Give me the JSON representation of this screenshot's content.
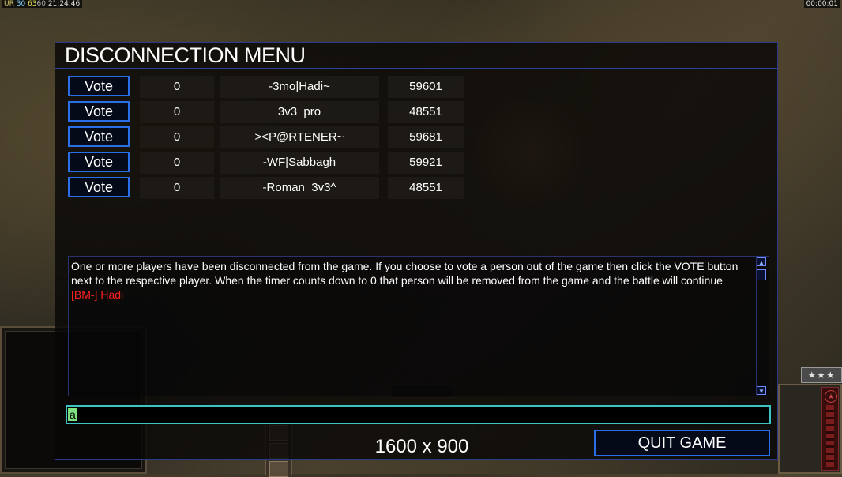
{
  "hud": {
    "top_left": {
      "label": "UR",
      "fps": "30",
      "ping": "63",
      "ping2": "60",
      "clock": "21:24:46"
    },
    "top_right_timer": "00:00:01",
    "rank_stars": "★★★"
  },
  "dialog": {
    "title": "DISCONNECTION MENU",
    "players": [
      {
        "vote_label": "Vote",
        "count": "0",
        "name": "-3mo|Hadi~",
        "id": "59601"
      },
      {
        "vote_label": "Vote",
        "count": "0",
        "name": "3v3  pro",
        "id": "48551"
      },
      {
        "vote_label": "Vote",
        "count": "0",
        "name": "><P@RTENER~",
        "id": "59681"
      },
      {
        "vote_label": "Vote",
        "count": "0",
        "name": "-WF|Sabbagh",
        "id": "59921"
      },
      {
        "vote_label": "Vote",
        "count": "0",
        "name": "-Roman_3v3^",
        "id": "48551"
      }
    ],
    "message": "One or more players have been disconnected from the game. If you choose to vote a person out of the game then click the VOTE button next to the respective player. When the timer counts down to 0 that person will be removed from the game and the battle will continue",
    "chat_line": "[BM-] Hadi",
    "chat_input_value": "a",
    "resolution_label": "1600 x 900",
    "quit_label": "QUIT GAME"
  },
  "colors": {
    "button_border": "#2a6fe8",
    "chat_input_border": "#3cc4c4",
    "chat_text": "#ff2020",
    "caret": "#7ee07e"
  }
}
